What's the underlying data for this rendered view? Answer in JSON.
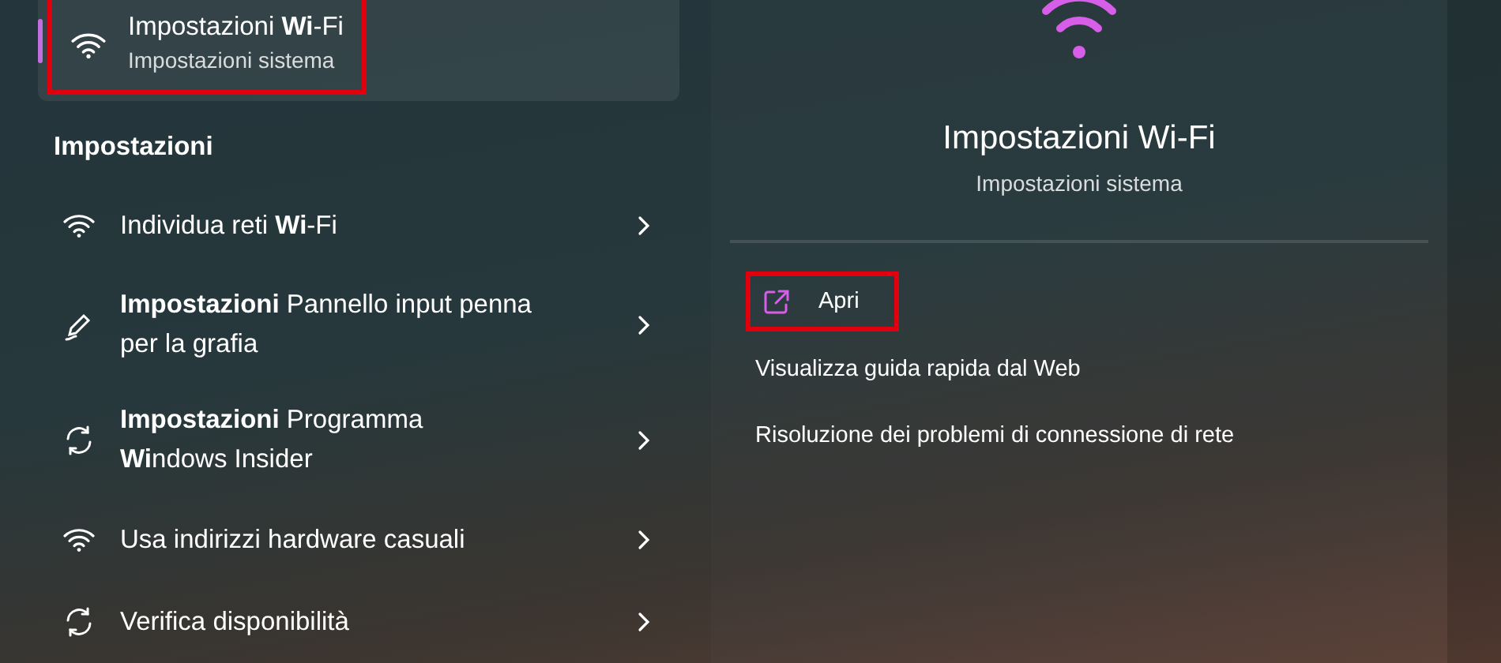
{
  "top_result": {
    "title": "Impostazioni **Wi**-Fi",
    "subtitle": "Impostazioni sistema",
    "kind": "wifi",
    "selected": true,
    "highlighted": true
  },
  "section_heading": "Impostazioni",
  "results": [
    {
      "kind": "wifi",
      "lines": [
        "Individua reti **Wi**-Fi"
      ]
    },
    {
      "kind": "pen",
      "lines": [
        "**Impostazioni** Pannello input penna",
        "per la grafia"
      ]
    },
    {
      "kind": "refresh",
      "lines": [
        "**Impostazioni** Programma",
        "**Wi**ndows Insider"
      ]
    },
    {
      "kind": "wifi",
      "lines": [
        "Usa indirizzi hardware casuali"
      ]
    },
    {
      "kind": "refresh",
      "lines": [
        "Verifica disponibilità"
      ]
    }
  ],
  "detail": {
    "title": "Impostazioni Wi-Fi",
    "subtitle": "Impostazioni sistema",
    "actions": [
      {
        "kind": "open",
        "label": "Apri",
        "highlighted": true
      },
      {
        "kind": "link",
        "label": "Visualizza guida rapida dal Web"
      },
      {
        "kind": "link",
        "label": "Risoluzione dei problemi di connessione di rete"
      }
    ]
  }
}
